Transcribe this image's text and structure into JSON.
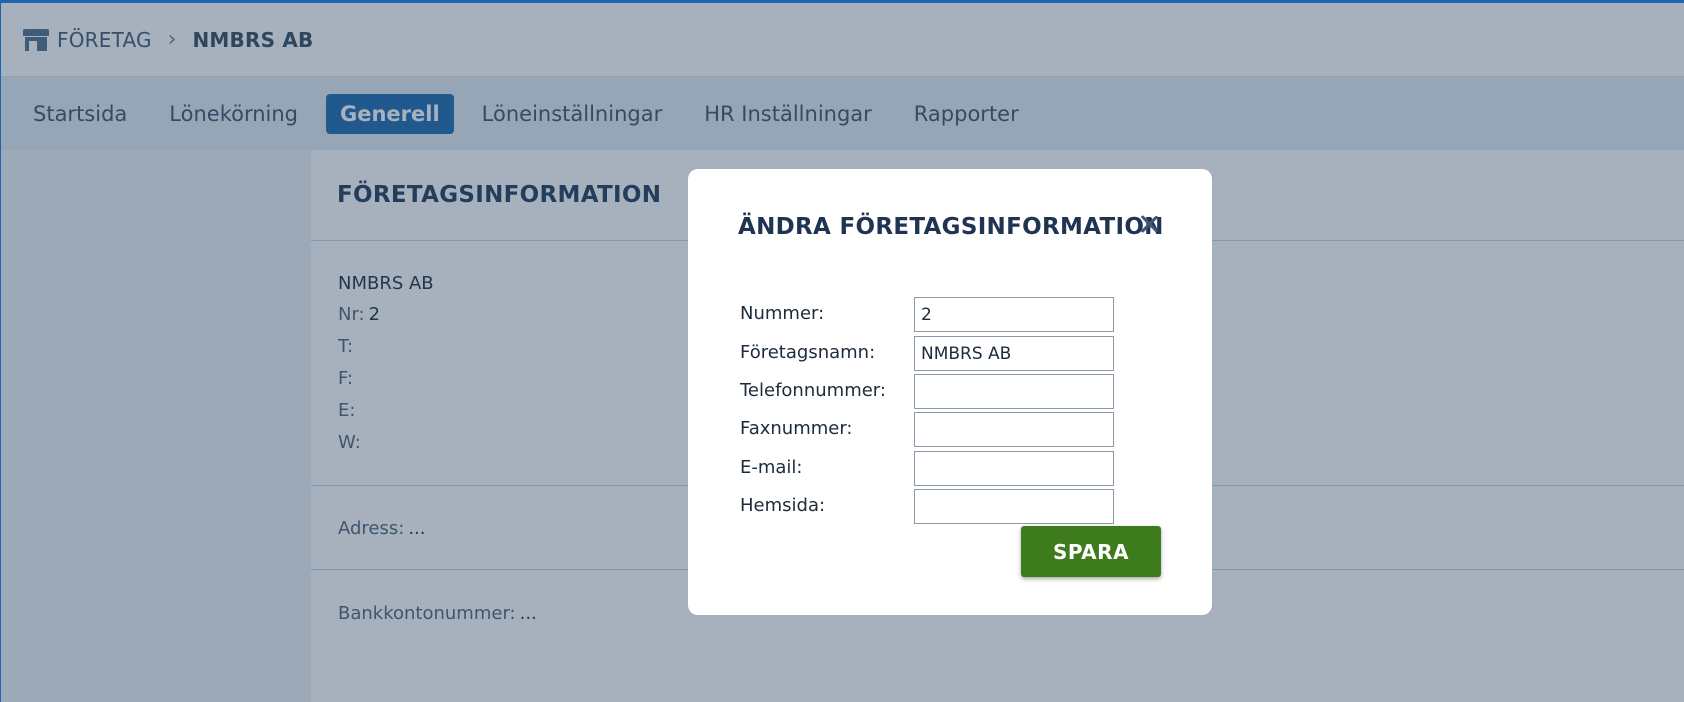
{
  "breadcrumb": {
    "root": "FÖRETAG",
    "separator": "›",
    "current": "NMBRS AB"
  },
  "nav": {
    "items": [
      {
        "label": "Startsida",
        "active": false
      },
      {
        "label": "Lönekörning",
        "active": false
      },
      {
        "label": "Generell",
        "active": true
      },
      {
        "label": "Löneinställningar",
        "active": false
      },
      {
        "label": "HR Inställningar",
        "active": false
      },
      {
        "label": "Rapporter",
        "active": false
      }
    ]
  },
  "card": {
    "title": "FÖRETAGSINFORMATION",
    "company_name": "NMBRS AB",
    "nr_label": "Nr:",
    "nr_value": "2",
    "t_label": "T:",
    "f_label": "F:",
    "e_label": "E:",
    "w_label": "W:",
    "address_label": "Adress:",
    "address_value": "...",
    "bank_label": "Bankkontonummer:",
    "bank_value": "..."
  },
  "modal": {
    "title": "ÄNDRA FÖRETAGSINFORMATION",
    "fields": [
      {
        "label": "Nummer:",
        "value": "2"
      },
      {
        "label": "Företagsnamn:",
        "value": "NMBRS AB"
      },
      {
        "label": "Telefonnummer:",
        "value": ""
      },
      {
        "label": "Faxnummer:",
        "value": ""
      },
      {
        "label": "E-mail:",
        "value": ""
      },
      {
        "label": "Hemsida:",
        "value": ""
      }
    ],
    "save_label": "SPARA"
  },
  "colors": {
    "accent": "#1b66ad",
    "save_button": "#3e7b1c",
    "overlay": "#2c4662"
  },
  "icons": {
    "breadcrumb": "store-icon",
    "close": "close-icon"
  }
}
